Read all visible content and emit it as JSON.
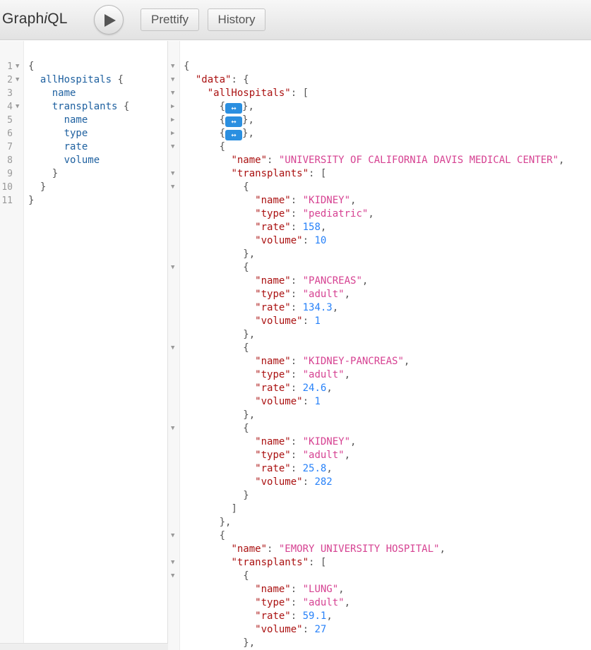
{
  "app": {
    "title_prefix": "Graph",
    "title_italic": "i",
    "title_suffix": "QL",
    "play_icon": "play-icon",
    "prettify_label": "Prettify",
    "history_label": "History"
  },
  "query": {
    "line_numbers": [
      "1",
      "2",
      "3",
      "4",
      "5",
      "6",
      "7",
      "8",
      "9",
      "10",
      "11"
    ],
    "lines": [
      {
        "indent": "",
        "text": "{"
      },
      {
        "indent": "  ",
        "text": "allHospitals {"
      },
      {
        "indent": "    ",
        "text": "name"
      },
      {
        "indent": "    ",
        "text": "transplants {"
      },
      {
        "indent": "      ",
        "text": "name"
      },
      {
        "indent": "      ",
        "text": "type"
      },
      {
        "indent": "      ",
        "text": "rate"
      },
      {
        "indent": "      ",
        "text": "volume"
      },
      {
        "indent": "    ",
        "text": "}"
      },
      {
        "indent": "  ",
        "text": "}"
      },
      {
        "indent": "",
        "text": "}"
      }
    ]
  },
  "result": {
    "collapse_icon": "expand-arrows-icon",
    "collapsed_glyph": "↔",
    "open_brace": "{",
    "data_key": "\"data\"",
    "all_hospitals_key": "\"allHospitals\"",
    "hospital_1_name": "\"UNIVERSITY OF CALIFORNIA DAVIS MEDICAL CENTER\"",
    "hospital_1_transplants": [
      {
        "name": "\"KIDNEY\"",
        "type": "\"pediatric\"",
        "rate": "158",
        "volume": "10"
      },
      {
        "name": "\"PANCREAS\"",
        "type": "\"adult\"",
        "rate": "134.3",
        "volume": "1"
      },
      {
        "name": "\"KIDNEY-PANCREAS\"",
        "type": "\"adult\"",
        "rate": "24.6",
        "volume": "1"
      },
      {
        "name": "\"KIDNEY\"",
        "type": "\"adult\"",
        "rate": "25.8",
        "volume": "282"
      }
    ],
    "hospital_2_name": "\"EMORY UNIVERSITY HOSPITAL\"",
    "hospital_2_transplants": [
      {
        "name": "\"LUNG\"",
        "type": "\"adult\"",
        "rate": "59.1",
        "volume": "27"
      }
    ],
    "keys": {
      "name": "\"name\"",
      "type": "\"type\"",
      "rate": "\"rate\"",
      "volume": "\"volume\"",
      "transplants": "\"transplants\""
    }
  }
}
